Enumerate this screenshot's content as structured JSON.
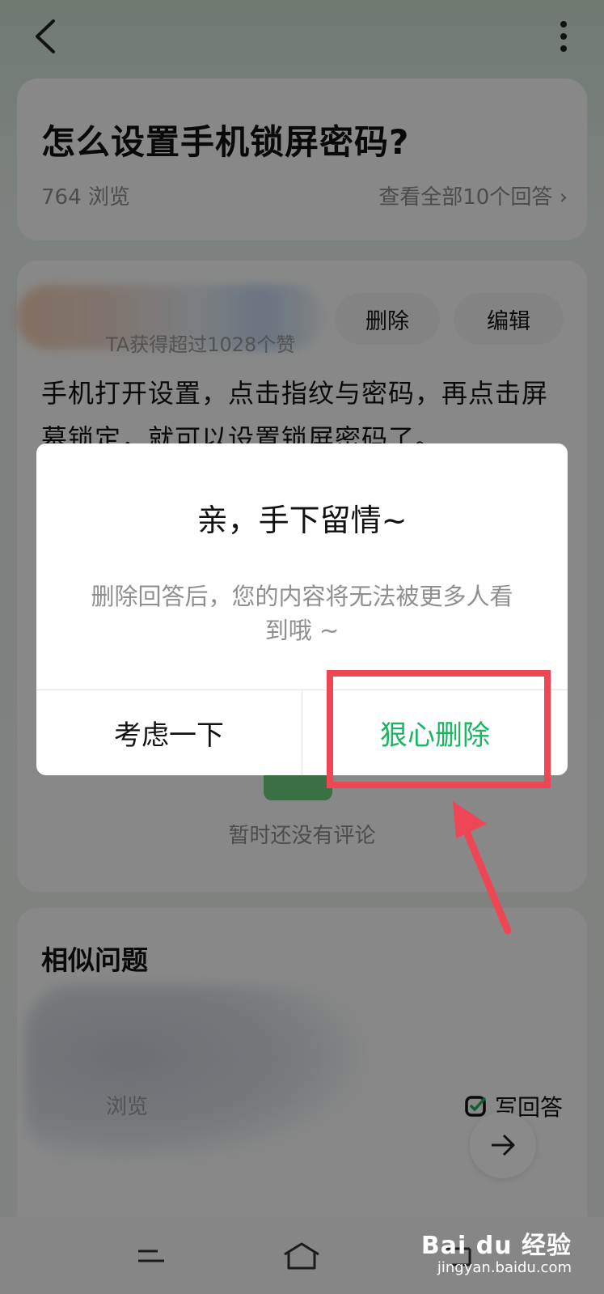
{
  "question": {
    "title": "怎么设置手机锁屏密码?",
    "views": "764 浏览",
    "all_answers": "查看全部10个回答"
  },
  "answer": {
    "likes_text": "TA获得超过1028个赞",
    "delete_label": "删除",
    "edit_label": "编辑",
    "content": "手机打开设置，点击指纹与密码，再点击屏幕锁定，就可以设置锁屏密码了。",
    "no_comment": "暂时还没有评论"
  },
  "similar": {
    "title": "相似问题",
    "views_suffix": "浏览",
    "write_answer": "写回答"
  },
  "dialog": {
    "title": "亲，手下留情~",
    "message": "删除回答后，您的内容将无法被更多人看到哦 ~",
    "cancel_label": "考虑一下",
    "confirm_label": "狠心删除"
  },
  "watermark": {
    "logo": "Bai du 经验",
    "url": "jingyan.baidu.com"
  },
  "colors": {
    "accent_green": "#1bb462",
    "highlight_red": "#ef4655"
  }
}
